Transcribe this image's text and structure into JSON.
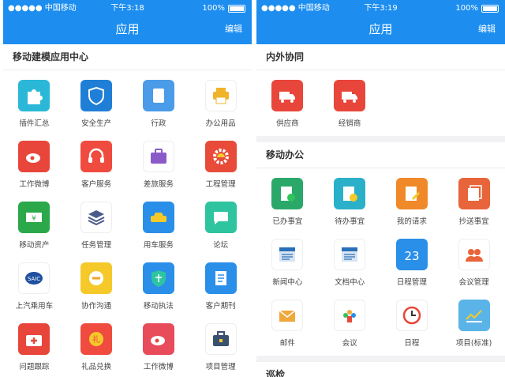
{
  "left": {
    "status": {
      "carrier": "●●●●● 中国移动",
      "time": "下午3:18",
      "battery": "100%"
    },
    "nav": {
      "title": "应用",
      "edit": "编辑"
    },
    "section": {
      "title": "移动建模应用中心",
      "items": [
        {
          "label": "插件汇总",
          "icon": "puzzle-icon",
          "color": "#2bb8d8"
        },
        {
          "label": "安全生产",
          "icon": "shield-icon",
          "color": "#1f7fd6"
        },
        {
          "label": "行政",
          "icon": "document-icon",
          "color": "#4a9be8"
        },
        {
          "label": "办公用品",
          "icon": "printer-icon",
          "color": "#ffffff"
        },
        {
          "label": "工作微博",
          "icon": "weibo-icon",
          "color": "#e8463a"
        },
        {
          "label": "客户服务",
          "icon": "headset-icon",
          "color": "#f04b3f"
        },
        {
          "label": "差旅服务",
          "icon": "suitcase-icon",
          "color": "#ffffff"
        },
        {
          "label": "工程管理",
          "icon": "gear-helmet-icon",
          "color": "#e84b3a"
        },
        {
          "label": "移动资产",
          "icon": "money-icon",
          "color": "#2aa84a"
        },
        {
          "label": "任务管理",
          "icon": "layers-icon",
          "color": "#ffffff"
        },
        {
          "label": "用车服务",
          "icon": "car-icon",
          "color": "#2a8fe8"
        },
        {
          "label": "论坛",
          "icon": "chat-icon",
          "color": "#2ec4a0"
        },
        {
          "label": "上汽乘用车",
          "icon": "saic-logo-icon",
          "color": "#ffffff"
        },
        {
          "label": "协作沟通",
          "icon": "handshake-icon",
          "color": "#f5c92a"
        },
        {
          "label": "移动执法",
          "icon": "law-icon",
          "color": "#2a8fe8"
        },
        {
          "label": "客户期刊",
          "icon": "journal-icon",
          "color": "#2a8fe8"
        },
        {
          "label": "问题跟踪",
          "icon": "medkit-icon",
          "color": "#e8463a"
        },
        {
          "label": "礼品兑换",
          "icon": "gift-icon",
          "color": "#f04b3f"
        },
        {
          "label": "工作微博",
          "icon": "weibo-icon",
          "color": "#e84b5a"
        },
        {
          "label": "项目管理",
          "icon": "briefcase-icon",
          "color": "#ffffff"
        }
      ]
    }
  },
  "right": {
    "status": {
      "carrier": "●●●●● 中国移动",
      "time": "下午3:19",
      "battery": "100%"
    },
    "nav": {
      "title": "应用",
      "edit": "编辑"
    },
    "sections": [
      {
        "title": "内外协同",
        "items": [
          {
            "label": "供应商",
            "icon": "truck-icon",
            "color": "#e8463a"
          },
          {
            "label": "经销商",
            "icon": "truck-icon",
            "color": "#e8463a"
          }
        ]
      },
      {
        "title": "移动办公",
        "items": [
          {
            "label": "已办事宜",
            "icon": "doc-check-icon",
            "color": "#2aa86a"
          },
          {
            "label": "待办事宜",
            "icon": "doc-clock-icon",
            "color": "#2ab0c8"
          },
          {
            "label": "我的请求",
            "icon": "doc-pen-icon",
            "color": "#f0892a"
          },
          {
            "label": "抄送事宜",
            "icon": "doc-copy-icon",
            "color": "#e8643a"
          },
          {
            "label": "新闻中心",
            "icon": "news-icon",
            "color": "#ffffff"
          },
          {
            "label": "文档中心",
            "icon": "news-icon",
            "color": "#ffffff"
          },
          {
            "label": "日程管理",
            "icon": "calendar-icon",
            "color": "#2a8fe8"
          },
          {
            "label": "会议管理",
            "icon": "people-icon",
            "color": "#ffffff"
          },
          {
            "label": "邮件",
            "icon": "mail-icon",
            "color": "#ffffff"
          },
          {
            "label": "会议",
            "icon": "meeting-icon",
            "color": "#ffffff"
          },
          {
            "label": "日程",
            "icon": "clock-icon",
            "color": "#ffffff"
          },
          {
            "label": "项目(标准)",
            "icon": "chart-icon",
            "color": "#5ab4e8"
          }
        ]
      },
      {
        "title": "巡检",
        "items": []
      }
    ],
    "calendar_day": "23"
  }
}
